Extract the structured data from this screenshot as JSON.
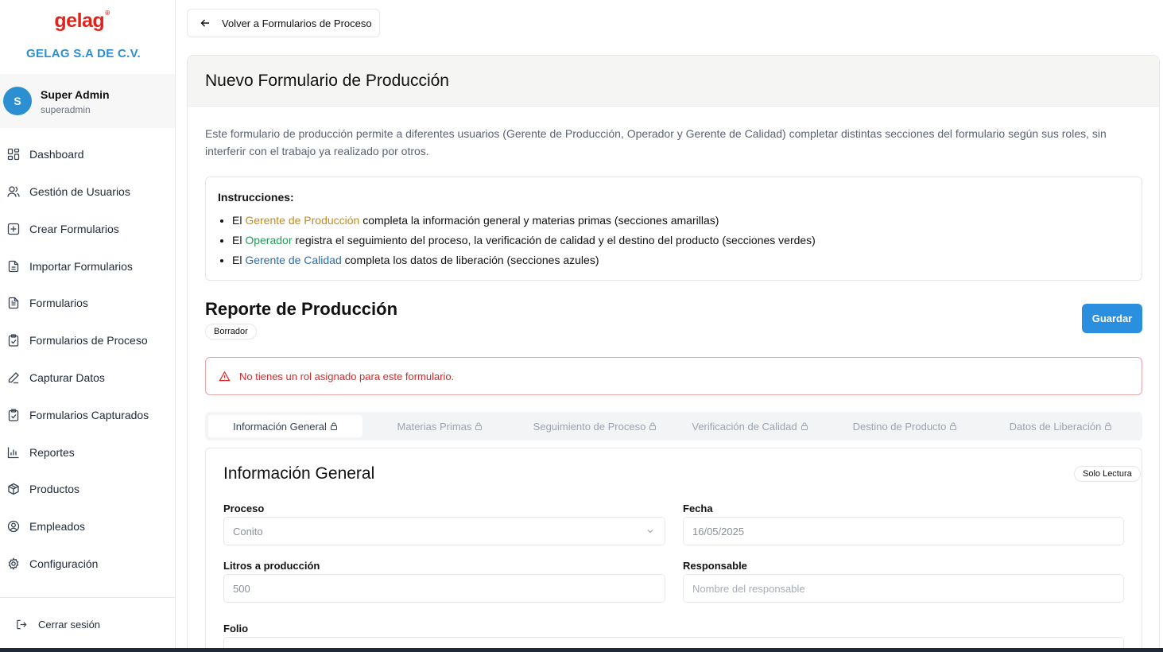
{
  "brand": {
    "logo_text": "gelag",
    "logo_mark": "®",
    "company": "GELAG S.A DE C.V.",
    "logo_color": "#e2231a",
    "accent_color": "#2b8fd1"
  },
  "user": {
    "initial": "S",
    "name": "Super Admin",
    "handle": "superadmin"
  },
  "sidebar": {
    "items": [
      {
        "label": "Dashboard",
        "icon": "dashboard-icon"
      },
      {
        "label": "Gestión de Usuarios",
        "icon": "users-icon"
      },
      {
        "label": "Crear Formularios",
        "icon": "plus-square-icon"
      },
      {
        "label": "Importar Formularios",
        "icon": "file-icon"
      },
      {
        "label": "Formularios",
        "icon": "file-text-icon"
      },
      {
        "label": "Formularios de Proceso",
        "icon": "clipboard-check-icon"
      },
      {
        "label": "Capturar Datos",
        "icon": "pen-icon"
      },
      {
        "label": "Formularios Capturados",
        "icon": "clipboard-check-icon"
      },
      {
        "label": "Reportes",
        "icon": "bar-chart-icon"
      },
      {
        "label": "Productos",
        "icon": "package-icon"
      },
      {
        "label": "Empleados",
        "icon": "user-circle-icon"
      },
      {
        "label": "Configuración",
        "icon": "gear-icon"
      }
    ],
    "logout_label": "Cerrar sesión"
  },
  "header": {
    "back_label": "Volver a Formularios de Proceso"
  },
  "card": {
    "title": "Nuevo Formulario de Producción",
    "description": "Este formulario de producción permite a diferentes usuarios (Gerente de Producción, Operador y Gerente de Calidad) completar distintas secciones del formulario según sus roles, sin interferir con el trabajo ya realizado por otros."
  },
  "instructions": {
    "title": "Instrucciones:",
    "items": [
      {
        "prefix": "El ",
        "role": "Gerente de Producción",
        "text": " completa la información general y materias primas (secciones amarillas)"
      },
      {
        "prefix": "El ",
        "role": "Operador",
        "text": " registra el seguimiento del proceso, la verificación de calidad y el destino del producto (secciones verdes)"
      },
      {
        "prefix": "El ",
        "role": "Gerente de Calidad",
        "text": " completa los datos de liberación (secciones azules)"
      }
    ]
  },
  "report": {
    "title": "Reporte de Producción",
    "status_badge": "Borrador",
    "save_label": "Guardar",
    "alert_text": "No tienes un rol asignado para este formulario."
  },
  "tabs": [
    {
      "label": "Información General",
      "active": true
    },
    {
      "label": "Materias Primas",
      "active": false
    },
    {
      "label": "Seguimiento de Proceso",
      "active": false
    },
    {
      "label": "Verificación de Calidad",
      "active": false
    },
    {
      "label": "Destino de Producto",
      "active": false
    },
    {
      "label": "Datos de Liberación",
      "active": false
    }
  ],
  "section": {
    "title": "Información General",
    "badge": "Solo Lectura",
    "fields": {
      "proceso": {
        "label": "Proceso",
        "value": "Conito"
      },
      "fecha": {
        "label": "Fecha",
        "value": "16/05/2025"
      },
      "litros": {
        "label": "Litros a producción",
        "value": "500"
      },
      "responsable": {
        "label": "Responsable",
        "placeholder": "Nombre del responsable"
      },
      "folio": {
        "label": "Folio"
      }
    }
  },
  "colors": {
    "primary_button": "#2b8fe0",
    "role_produccion": "#c48b1a",
    "role_operador": "#1f9d55",
    "role_calidad": "#2b6cb0",
    "alert": "#dc2626"
  }
}
